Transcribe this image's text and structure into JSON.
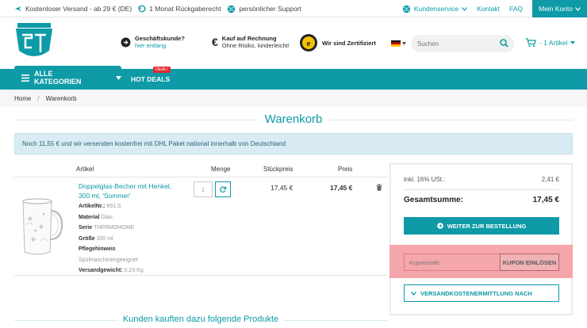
{
  "topbar": {
    "shipping": "Kostenloser Versand - ab 29 € (DE)",
    "return": "1 Monat Rückgaberecht",
    "support": "persönlicher Support",
    "service": "Kundenservice",
    "contact": "Kontakt",
    "faq": "FAQ",
    "account": "Mein Konto"
  },
  "header": {
    "business_title": "Geschäftskunde?",
    "business_link": "hier entlang",
    "invoice_title": "Kauf auf Rechnung",
    "invoice_sub": "Ohne Risiko, kinderleicht!",
    "certified": "Wir sind Zertifiziert",
    "trusted_letter": "e",
    "search_placeholder": "Suchen",
    "cart": "- 1 Artikel"
  },
  "nav": {
    "all_categories": "ALLE KATEGORIEN",
    "hot_deals": "HOT DEALS",
    "deal_badge": "DEAL!"
  },
  "breadcrumb": {
    "home": "Home",
    "sep": "/",
    "current": "Warenkorb"
  },
  "page_title": "Warenkorb",
  "info": "Noch 11,55 € und wir versenden kostenfrei mit DHL Paket national innerhalb von Deutschland",
  "table": {
    "col_article": "Artikel",
    "col_qty": "Menge",
    "col_unit": "Stückpreis",
    "col_price": "Preis"
  },
  "product": {
    "name": "Doppelglas-Becher mit Henkel, 300 ml, 'Sommer'",
    "attrs": [
      {
        "label": "ArtikelNr.:",
        "value": "891.S"
      },
      {
        "label": "Material",
        "value": "Glas"
      },
      {
        "label": "Serie",
        "value": "THERMOHOME"
      },
      {
        "label": "Größe",
        "value": "300 ml"
      },
      {
        "label": "Pflegehinweis",
        "value": ""
      },
      {
        "label": "",
        "value": "Spülmaschinengeeignet"
      },
      {
        "label": "Versandgewicht:",
        "value": "0,23 Kg"
      }
    ],
    "qty": "1",
    "unit_price": "17,45 €",
    "total": "17,45 €"
  },
  "summary": {
    "vat_label": "inkl. 16% USt.:",
    "vat_value": "2,41 €",
    "total_label": "Gesamtsumme:",
    "total_value": "17,45 €",
    "checkout": "WEITER ZUR BESTELLUNG",
    "coupon_placeholder": "Kuponcode",
    "coupon_button": "KUPON EINLÖSEN",
    "shipping_calc": "VERSANDKOSTENERMITTLUNG NACH"
  },
  "bottom_title": "Kunden kauften dazu folgende Produkte",
  "colors": {
    "accent": "#0e9aa7",
    "highlight": "#f4a6ab",
    "deal": "#e3282c"
  },
  "icons": [
    "plane-icon",
    "return-icon",
    "globe-icon",
    "chevron-down-icon",
    "arrow-circle-icon",
    "euro-icon",
    "trusted-shops-icon",
    "flag-de-icon",
    "search-icon",
    "cart-icon",
    "menu-icon",
    "refresh-icon",
    "trash-icon"
  ]
}
